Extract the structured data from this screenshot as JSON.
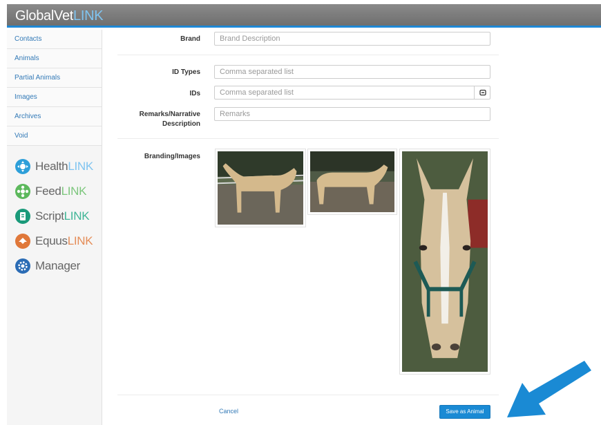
{
  "header": {
    "logo_main": "GlobalVet",
    "logo_accent": "LINK",
    "accent_color": "#1e88d6"
  },
  "sidebar": {
    "items": [
      {
        "label": "Contacts"
      },
      {
        "label": "Animals"
      },
      {
        "label": "Partial Animals"
      },
      {
        "label": "Images"
      },
      {
        "label": "Archives"
      },
      {
        "label": "Void"
      }
    ],
    "apps": [
      {
        "name": "Health",
        "suffix": "LINK",
        "color": "#2d9fd9",
        "icon": "health-icon"
      },
      {
        "name": "Feed",
        "suffix": "LINK",
        "color": "#5cb85c",
        "icon": "feed-icon"
      },
      {
        "name": "Script",
        "suffix": "LINK",
        "color": "#1a9a7a",
        "icon": "script-icon"
      },
      {
        "name": "Equus",
        "suffix": "LINK",
        "color": "#e0783a",
        "icon": "equus-icon"
      },
      {
        "name": "Manager",
        "suffix": "",
        "color": "#2b6cb5",
        "icon": "gear-icon"
      }
    ]
  },
  "form": {
    "brand": {
      "label": "Brand",
      "placeholder": "Brand Description",
      "value": ""
    },
    "id_types": {
      "label": "ID Types",
      "placeholder": "Comma separated list",
      "value": ""
    },
    "ids": {
      "label": "IDs",
      "placeholder": "Comma separated list",
      "value": ""
    },
    "remarks": {
      "label": "Remarks/Narrative",
      "label2": "Description",
      "placeholder": "Remarks",
      "value": ""
    },
    "images": {
      "label": "Branding/Images",
      "photos": [
        {
          "alt": "palomino-horse-side-view"
        },
        {
          "alt": "palomino-horse-side-view-2"
        },
        {
          "alt": "palomino-horse-face-closeup"
        }
      ]
    }
  },
  "actions": {
    "cancel_label": "Cancel",
    "save_label": "Save as Animal",
    "save_color": "#1a8ad4"
  },
  "annotation": {
    "arrow_color": "#1a8ad4"
  }
}
